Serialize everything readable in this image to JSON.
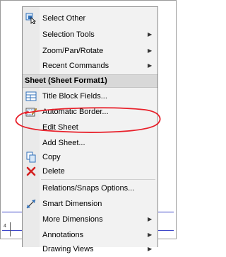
{
  "menu": {
    "items_top": [
      {
        "id": "select-other",
        "label": "Select Other",
        "icon": "select-other-icon",
        "submenu": false
      },
      {
        "id": "selection-tools",
        "label": "Selection Tools",
        "icon": "",
        "submenu": true
      },
      {
        "id": "zoom-pan-rotate",
        "label": "Zoom/Pan/Rotate",
        "icon": "",
        "submenu": true
      },
      {
        "id": "recent-commands",
        "label": "Recent Commands",
        "icon": "",
        "submenu": true
      }
    ],
    "section_header": "Sheet (Sheet Format1)",
    "items_sheet": [
      {
        "id": "title-block-fields",
        "label": "Title Block Fields...",
        "icon": "title-block-icon",
        "submenu": false
      },
      {
        "id": "automatic-border",
        "label": "Automatic Border...",
        "icon": "automatic-border-icon",
        "submenu": false
      },
      {
        "id": "edit-sheet",
        "label": "Edit Sheet",
        "icon": "",
        "submenu": false
      },
      {
        "id": "add-sheet",
        "label": "Add Sheet...",
        "icon": "",
        "submenu": false
      },
      {
        "id": "copy",
        "label": "Copy",
        "icon": "copy-icon",
        "submenu": false
      },
      {
        "id": "delete",
        "label": "Delete",
        "icon": "delete-icon",
        "submenu": false
      }
    ],
    "items_bottom": [
      {
        "id": "relations-snaps",
        "label": "Relations/Snaps Options...",
        "icon": "",
        "submenu": false
      },
      {
        "id": "smart-dimension",
        "label": "Smart Dimension",
        "icon": "smart-dimension-icon",
        "submenu": false
      },
      {
        "id": "more-dimensions",
        "label": "More Dimensions",
        "icon": "",
        "submenu": true
      },
      {
        "id": "annotations",
        "label": "Annotations",
        "icon": "",
        "submenu": true
      },
      {
        "id": "drawing-views",
        "label": "Drawing Views",
        "icon": "",
        "submenu": true
      }
    ]
  },
  "colors": {
    "annotation_circle": "#e8202a",
    "drawing_line": "#3d46c8",
    "delete_red": "#d42020",
    "icon_blue": "#2f6fb8"
  },
  "background": {
    "left_marker": "4"
  }
}
